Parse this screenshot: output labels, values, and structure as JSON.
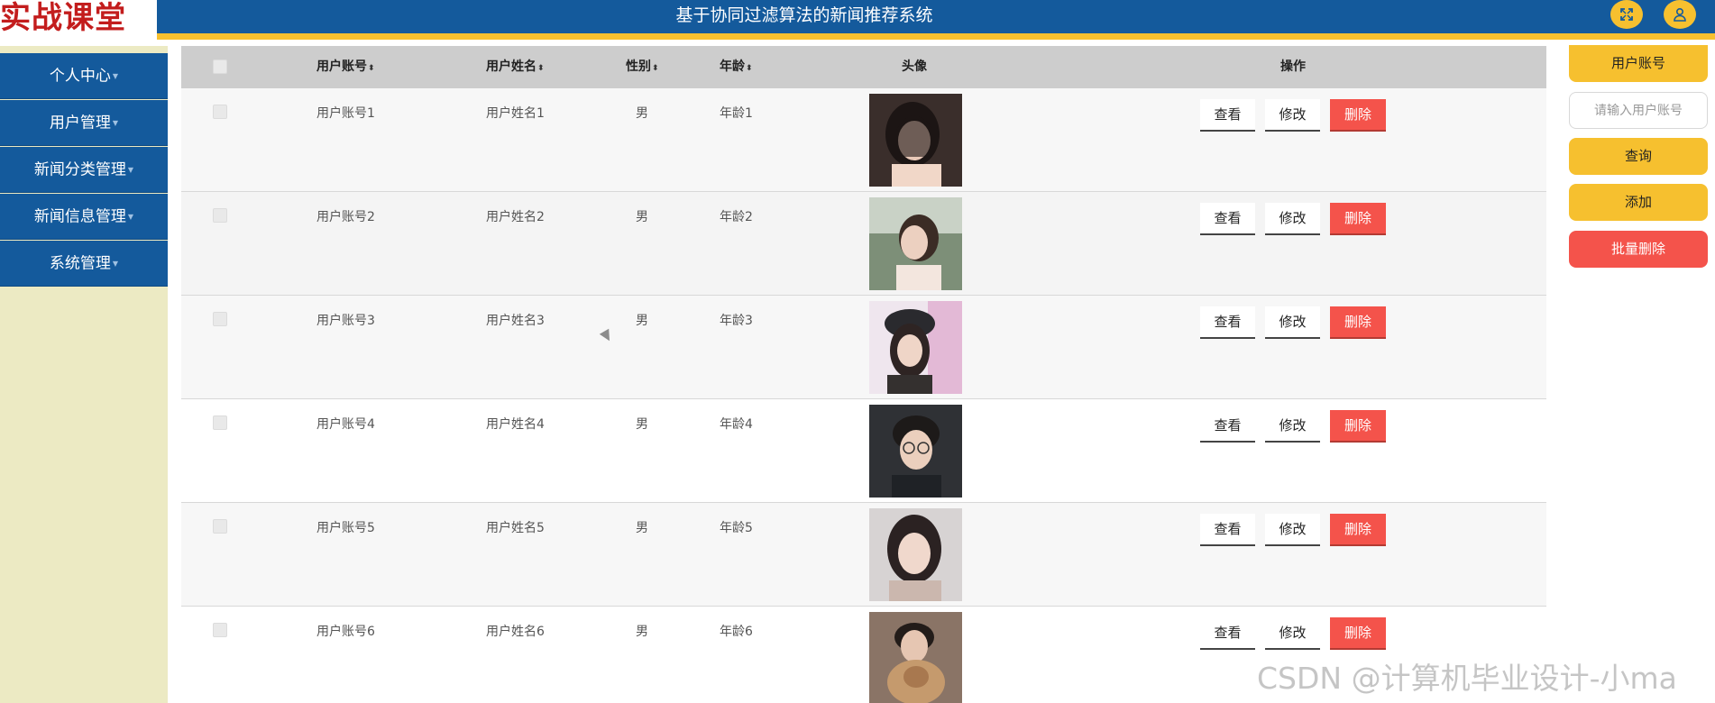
{
  "header": {
    "logo": "实战课堂",
    "title": "基于协同过滤算法的新闻推荐系统",
    "icons": [
      "fullscreen-icon",
      "user-icon"
    ]
  },
  "sidebar": {
    "items": [
      {
        "label": "个人中心"
      },
      {
        "label": "用户管理"
      },
      {
        "label": "新闻分类管理"
      },
      {
        "label": "新闻信息管理"
      },
      {
        "label": "系统管理"
      }
    ]
  },
  "table": {
    "columns": {
      "account": "用户账号",
      "name": "用户姓名",
      "gender": "性别",
      "age": "年龄",
      "avatar": "头像",
      "actions": "操作"
    },
    "rows": [
      {
        "account": "用户账号1",
        "name": "用户姓名1",
        "gender": "男",
        "age": "年龄1"
      },
      {
        "account": "用户账号2",
        "name": "用户姓名2",
        "gender": "男",
        "age": "年龄2"
      },
      {
        "account": "用户账号3",
        "name": "用户姓名3",
        "gender": "男",
        "age": "年龄3"
      },
      {
        "account": "用户账号4",
        "name": "用户姓名4",
        "gender": "男",
        "age": "年龄4"
      },
      {
        "account": "用户账号5",
        "name": "用户姓名5",
        "gender": "男",
        "age": "年龄5"
      },
      {
        "account": "用户账号6",
        "name": "用户姓名6",
        "gender": "男",
        "age": "年龄6"
      }
    ],
    "row_actions": {
      "view": "查看",
      "edit": "修改",
      "delete": "删除"
    }
  },
  "search_panel": {
    "label": "用户账号",
    "placeholder": "请输入用户账号",
    "query": "查询",
    "add": "添加",
    "batch_delete": "批量删除"
  },
  "watermark": "CSDN @计算机毕业设计-小ma",
  "colors": {
    "header_blue": "#145a9c",
    "accent_yellow": "#f6c02f",
    "danger_red": "#f4534b",
    "sidebar_bg": "#eceac3"
  }
}
